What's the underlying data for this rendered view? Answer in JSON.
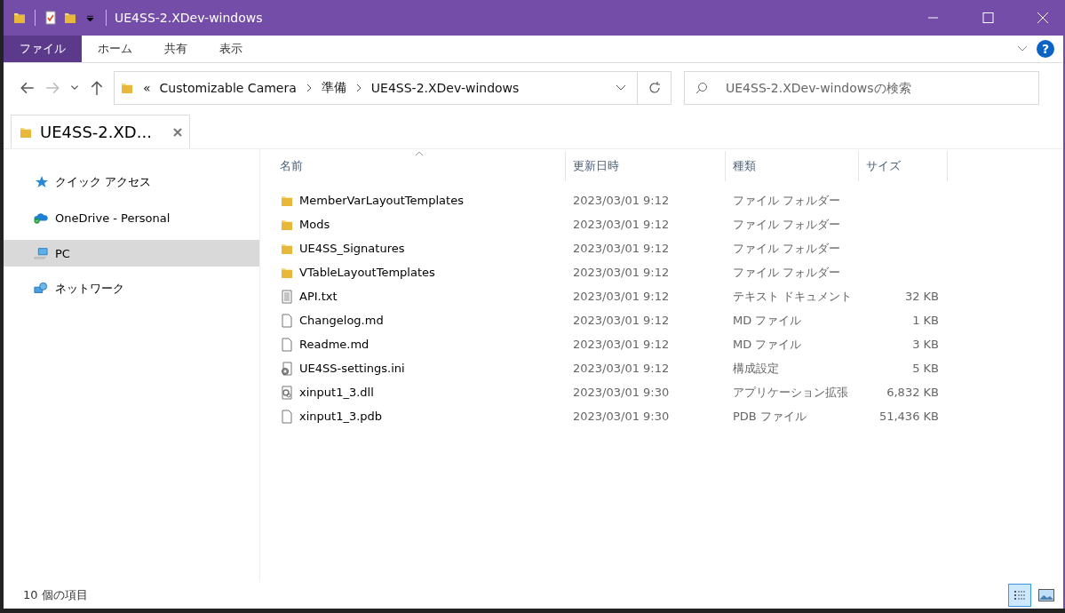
{
  "window": {
    "title": "UE4SS-2.XDev-windows"
  },
  "ribbon_tabs": [
    {
      "label": "ファイル",
      "selected": true
    },
    {
      "label": "ホーム",
      "selected": false
    },
    {
      "label": "共有",
      "selected": false
    },
    {
      "label": "表示",
      "selected": false
    }
  ],
  "help_label": "?",
  "address": {
    "overflow": "«",
    "segments": [
      "Customizable Camera",
      "準備",
      "UE4SS-2.XDev-windows"
    ]
  },
  "search": {
    "placeholder": "UE4SS-2.XDev-windowsの検索"
  },
  "tab": {
    "label": "UE4SS-2.XD..."
  },
  "sidebar": {
    "items": [
      {
        "label": "クイック アクセス",
        "kind": "quick",
        "selected": false
      },
      {
        "label": "OneDrive - Personal",
        "kind": "cloud",
        "selected": false
      },
      {
        "label": "PC",
        "kind": "pc",
        "selected": true
      },
      {
        "label": "ネットワーク",
        "kind": "network",
        "selected": false
      }
    ]
  },
  "table": {
    "columns": [
      "名前",
      "更新日時",
      "種類",
      "サイズ"
    ],
    "rows": [
      {
        "kind": "folder",
        "name": "MemberVarLayoutTemplates",
        "date": "2023/03/01 9:12",
        "type": "ファイル フォルダー"
      },
      {
        "kind": "folder",
        "name": "Mods",
        "date": "2023/03/01 9:12",
        "type": "ファイル フォルダー"
      },
      {
        "kind": "folder",
        "name": "UE4SS_Signatures",
        "date": "2023/03/01 9:12",
        "type": "ファイル フォルダー"
      },
      {
        "kind": "folder",
        "name": "VTableLayoutTemplates",
        "date": "2023/03/01 9:12",
        "type": "ファイル フォルダー"
      },
      {
        "kind": "text",
        "name": "API.txt",
        "date": "2023/03/01 9:12",
        "type": "テキスト ドキュメント",
        "size": "32 KB"
      },
      {
        "kind": "blank",
        "name": "Changelog.md",
        "date": "2023/03/01 9:12",
        "type": "MD ファイル",
        "size": "1 KB"
      },
      {
        "kind": "blank",
        "name": "Readme.md",
        "date": "2023/03/01 9:12",
        "type": "MD ファイル",
        "size": "3 KB"
      },
      {
        "kind": "settings",
        "name": "UE4SS-settings.ini",
        "date": "2023/03/01 9:12",
        "type": "構成設定",
        "size": "5 KB"
      },
      {
        "kind": "dll",
        "name": "xinput1_3.dll",
        "date": "2023/03/01 9:30",
        "type": "アプリケーション拡張",
        "size": "6,832 KB"
      },
      {
        "kind": "blank",
        "name": "xinput1_3.pdb",
        "date": "2023/03/01 9:30",
        "type": "PDB ファイル",
        "size": "51,436 KB"
      }
    ]
  },
  "status_bar": {
    "count": "10 個の項目",
    "views": [
      {
        "kind": "details",
        "selected": true
      },
      {
        "kind": "thumbnails",
        "selected": false
      }
    ]
  }
}
